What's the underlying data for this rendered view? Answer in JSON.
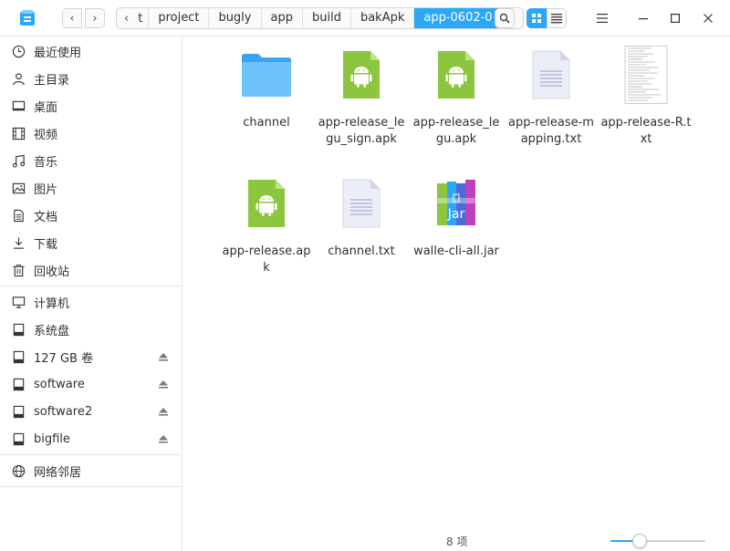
{
  "toolbar": {
    "breadcrumbs": [
      {
        "label": "t"
      },
      {
        "label": "project"
      },
      {
        "label": "bugly"
      },
      {
        "label": "app"
      },
      {
        "label": "build"
      },
      {
        "label": "bakApk"
      },
      {
        "label": "app-0602-0"
      }
    ],
    "icons": {
      "back": "chevron-left-icon",
      "forward": "chevron-right-icon",
      "search": "search-icon",
      "icon_view": "grid-view-icon",
      "list_view": "list-view-icon",
      "menu": "hamburger-menu-icon",
      "minimize": "minimize-icon",
      "maximize": "maximize-icon",
      "close": "close-icon"
    },
    "active_view": "icon"
  },
  "sidebar": {
    "quick": [
      {
        "label": "最近使用",
        "icon": "clock-icon"
      },
      {
        "label": "主目录",
        "icon": "home-icon"
      },
      {
        "label": "桌面",
        "icon": "desktop-icon"
      },
      {
        "label": "视频",
        "icon": "video-icon"
      },
      {
        "label": "音乐",
        "icon": "music-icon"
      },
      {
        "label": "图片",
        "icon": "picture-icon"
      },
      {
        "label": "文档",
        "icon": "document-icon"
      },
      {
        "label": "下载",
        "icon": "download-icon"
      },
      {
        "label": "回收站",
        "icon": "trash-icon"
      }
    ],
    "devices": [
      {
        "label": "计算机",
        "icon": "computer-icon",
        "eject": false
      },
      {
        "label": "系统盘",
        "icon": "drive-icon",
        "eject": false
      },
      {
        "label": "127 GB 卷",
        "icon": "drive-icon",
        "eject": true
      },
      {
        "label": "software",
        "icon": "drive-icon",
        "eject": true
      },
      {
        "label": "software2",
        "icon": "drive-icon",
        "eject": true
      },
      {
        "label": "bigfile",
        "icon": "drive-icon",
        "eject": true
      }
    ],
    "network": [
      {
        "label": "网络邻居",
        "icon": "network-icon"
      }
    ]
  },
  "files": [
    {
      "name": "channel",
      "type": "folder"
    },
    {
      "name": "app-release_legu_sign.apk",
      "type": "apk"
    },
    {
      "name": "app-release_legu.apk",
      "type": "apk"
    },
    {
      "name": "app-release-mapping.txt",
      "type": "txt"
    },
    {
      "name": "app-release-R.txt",
      "type": "txt-preview"
    },
    {
      "name": "app-release.apk",
      "type": "apk"
    },
    {
      "name": "channel.txt",
      "type": "txt"
    },
    {
      "name": "walle-cli-all.jar",
      "type": "jar"
    }
  ],
  "status": {
    "count_text": "8 项",
    "zoom_fraction": 0.27
  },
  "colors": {
    "accent": "#2ca7f8",
    "apk_green": "#8cc63f",
    "folder_blue": "#5ab8f5"
  }
}
